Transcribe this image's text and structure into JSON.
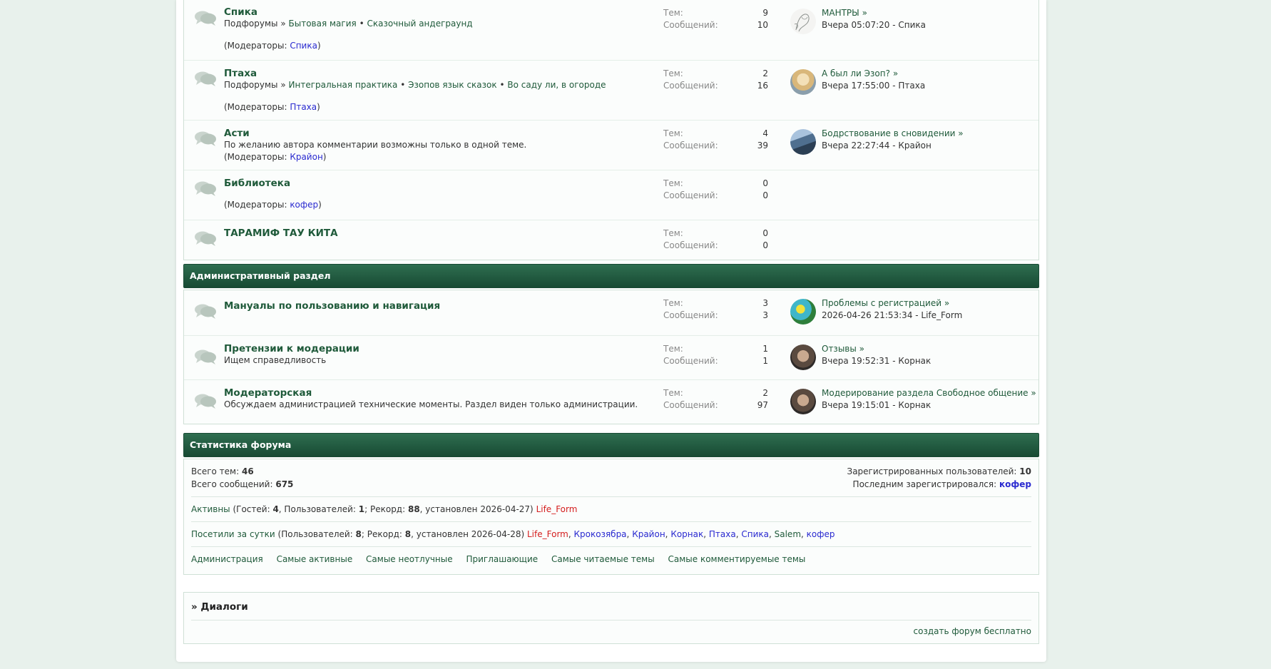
{
  "labels": {
    "topics": "Тем:",
    "messages": "Сообщений:",
    "subforums_prefix": "Подфорумы »",
    "moderators_prefix": "(Модераторы: ",
    "moderators_suffix": ")",
    "bullet": "•",
    "arrow": "»"
  },
  "section1": {
    "forums": [
      {
        "title": "Спика",
        "subforums": [
          "Бытовая магия",
          "Сказочный андеграунд"
        ],
        "moderator": "Спика",
        "topics": "9",
        "messages": "10",
        "last_title": "МАНТРЫ",
        "last_info": "Вчера 05:07:20 - Спика",
        "avatar": "sketch"
      },
      {
        "title": "Птаха",
        "subforums": [
          "Интегральная практика",
          "Эзопов язык сказок",
          "Во саду ли, в огороде"
        ],
        "moderator": "Птаха",
        "topics": "2",
        "messages": "16",
        "last_title": "А был ли Эзоп?",
        "last_info": "Вчера 17:55:00 - Птаха",
        "avatar": "blonde"
      },
      {
        "title": "Асти",
        "description": "По желанию автора комментарии возможны только в одной теме.",
        "moderator": "Крайон",
        "topics": "4",
        "messages": "39",
        "last_title": "Бодрствование в сновидении",
        "last_info": "Вчера 22:27:44 - Крайон",
        "avatar": "landscape"
      },
      {
        "title": "Библиотека",
        "moderator": "кофер",
        "topics": "0",
        "messages": "0"
      },
      {
        "title": "ТАРАМИФ ТАУ КИТА",
        "topics": "0",
        "messages": "0"
      }
    ]
  },
  "section2": {
    "title": "Административный раздел",
    "forums": [
      {
        "title": "Мануалы по пользованию и навигация",
        "topics": "3",
        "messages": "3",
        "last_title": "Проблемы с регистрацией",
        "last_info": "2026-04-26 21:53:34 - Life_Form",
        "avatar": "colorful"
      },
      {
        "title": "Претензии к модерации",
        "description": "Ищем справедливость",
        "topics": "1",
        "messages": "1",
        "last_title": "Отзывы",
        "last_info": "Вчера 19:52:31 - Корнак",
        "avatar": "man"
      },
      {
        "title": "Модераторская",
        "description": "Обсуждаем администрацией технические моменты. Раздел виден только администрации.",
        "topics": "2",
        "messages": "97",
        "last_title": "Модерирование раздела Свободное общение",
        "last_info": "Вчера 19:15:01 - Корнак",
        "avatar": "man"
      }
    ]
  },
  "stats": {
    "title": "Статистика форума",
    "total_topics_label": "Всего тем:",
    "total_topics": "46",
    "total_messages_label": "Всего сообщений:",
    "total_messages": "675",
    "registered_label": "Зарегистрированных пользователей:",
    "registered": "10",
    "last_registered_label": "Последним зарегистрировался:",
    "last_registered": "кофер",
    "active_link": "Активны",
    "active_a": " (Гостей: ",
    "active_guests": "4",
    "active_b": ", Пользователей: ",
    "active_users": "1",
    "active_c": "; Рекорд: ",
    "active_record": "88",
    "active_d": ", установлен 2026-04-27) ",
    "active_user": "Life_Form",
    "visited_link": "Посетили за сутки",
    "visited_a": " (Пользователей: ",
    "visited_users": "8",
    "visited_b": "; Рекорд: ",
    "visited_record": "8",
    "visited_c": ", установлен 2026-04-28) ",
    "visited_list": [
      "Life_Form",
      "Крокозябра",
      "Крайон",
      "Корнак",
      "Птаха",
      "Спика",
      "Salem",
      "кофер"
    ],
    "links": [
      "Администрация",
      "Самые активные",
      "Самые неотлучные",
      "Приглашающие",
      "Самые читаемые темы",
      "Самые комментируемые темы"
    ]
  },
  "dialogs": {
    "title": "» Диалоги",
    "footer_link": "создать форум бесплатно"
  },
  "colors": {
    "header_green": "#1f5a3a",
    "link_blue": "#2a2ad0",
    "user_red": "#d41e1e"
  }
}
